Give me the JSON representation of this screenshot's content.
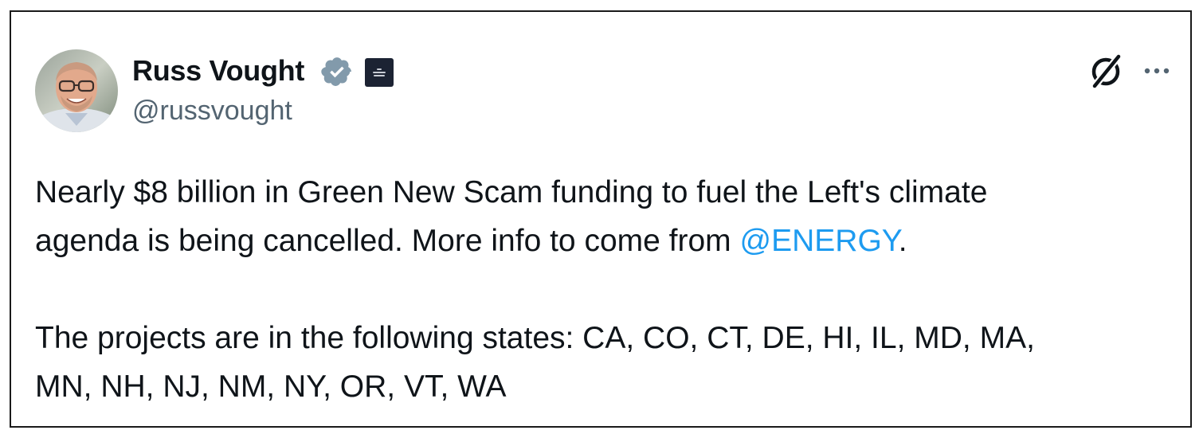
{
  "author": {
    "display_name": "Russ Vought",
    "handle": "@russvought",
    "verified": true,
    "verified_color": "#829aab",
    "affiliation_badge": "white-house-badge-icon",
    "avatar": "avatar-photo"
  },
  "actions": {
    "grok_icon": "grok-icon",
    "more_icon": "more-options-icon"
  },
  "tweet": {
    "line1": "Nearly $8 billion in Green New Scam funding to fuel the Left's climate",
    "line2_pre": "agenda is being cancelled. More info to come from ",
    "mention": "@ENERGY",
    "line2_post": ".",
    "line3": "The projects are in the following states: CA, CO, CT, DE, HI, IL, MD, MA,",
    "line4": "MN, NH, NJ, NM, NY, OR, VT, WA"
  },
  "colors": {
    "text": "#0f1419",
    "secondary": "#536471",
    "link": "#1d9bf0"
  }
}
